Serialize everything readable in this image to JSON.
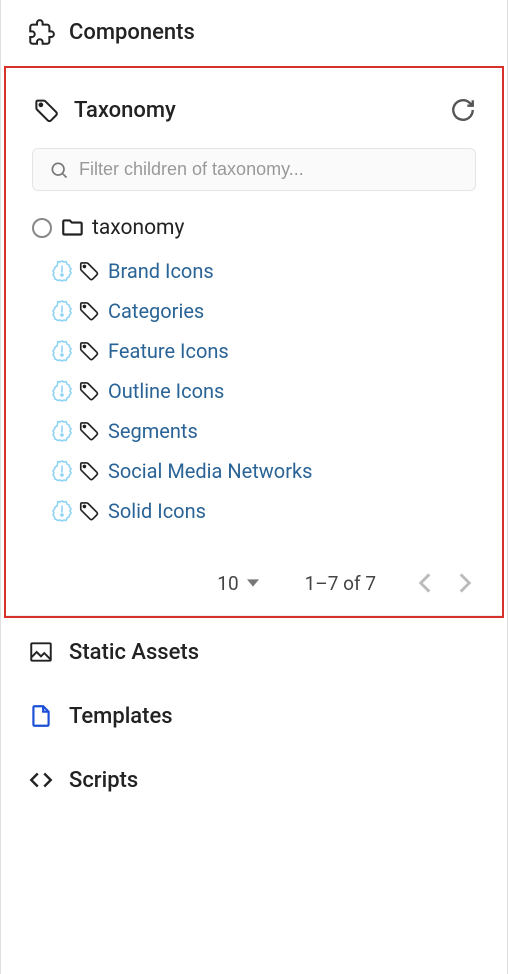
{
  "sections": {
    "components": {
      "label": "Components"
    },
    "taxonomy": {
      "label": "Taxonomy",
      "filter_placeholder": "Filter children of taxonomy...",
      "root_label": "taxonomy",
      "children": [
        {
          "label": "Brand Icons"
        },
        {
          "label": "Categories"
        },
        {
          "label": "Feature Icons"
        },
        {
          "label": "Outline Icons"
        },
        {
          "label": "Segments"
        },
        {
          "label": "Social Media Networks"
        },
        {
          "label": "Solid Icons"
        }
      ]
    },
    "static_assets": {
      "label": "Static Assets"
    },
    "templates": {
      "label": "Templates"
    },
    "scripts": {
      "label": "Scripts"
    }
  },
  "pager": {
    "page_size": "10",
    "range": "1–7 of 7"
  }
}
